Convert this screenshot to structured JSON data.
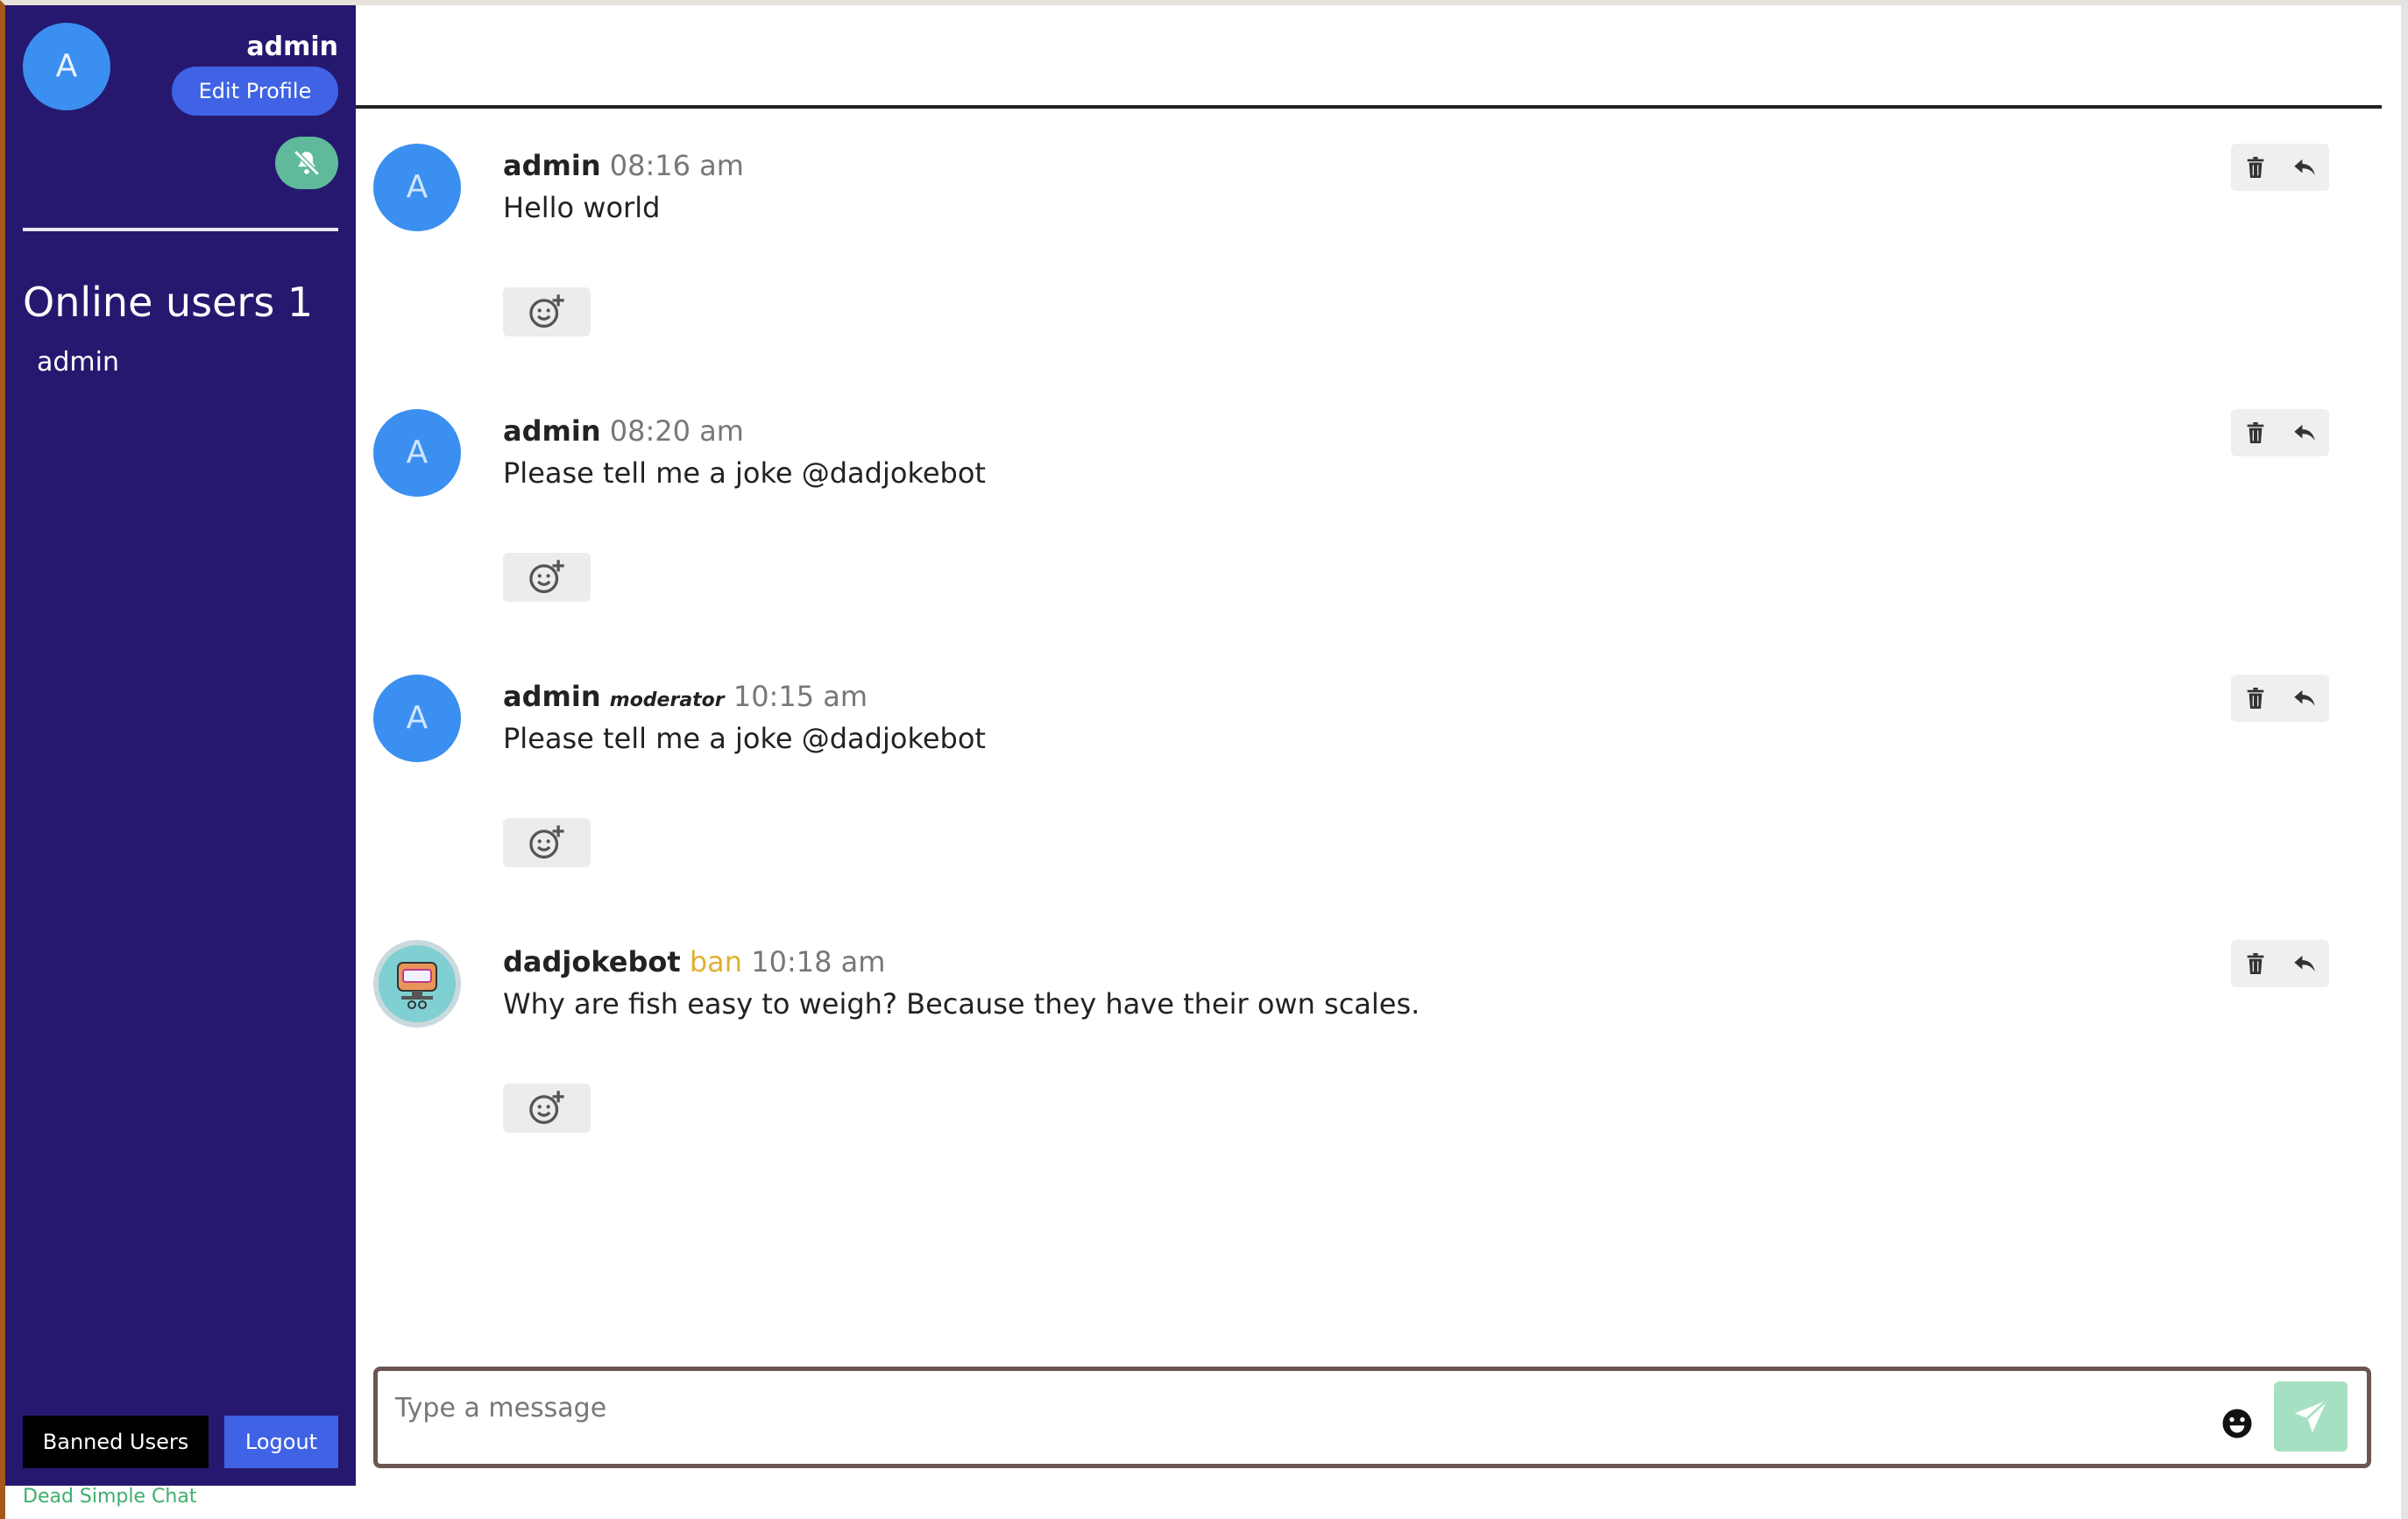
{
  "app": {
    "footer_link": "Dead Simple Chat"
  },
  "sidebar": {
    "avatar_letter": "A",
    "username": "admin",
    "edit_profile_label": "Edit Profile",
    "online_title": "Online users 1",
    "online_users": [
      "admin"
    ],
    "banned_users_label": "Banned Users",
    "logout_label": "Logout",
    "colors": {
      "background": "#26186f",
      "accent": "#3f63e4",
      "mute": "#5fb99a"
    }
  },
  "messages": [
    {
      "avatar_letter": "A",
      "author": "admin",
      "role": "",
      "ban": "",
      "time": "08:16 am",
      "text": "Hello world"
    },
    {
      "avatar_letter": "A",
      "author": "admin",
      "role": "",
      "ban": "",
      "time": "08:20 am",
      "text": "Please tell me a joke @dadjokebot"
    },
    {
      "avatar_letter": "A",
      "author": "admin",
      "role": "moderator",
      "ban": "",
      "time": "10:15 am",
      "text": "Please tell me a joke @dadjokebot"
    },
    {
      "avatar_letter": "",
      "author": "dadjokebot",
      "role": "",
      "ban": "ban",
      "time": "10:18 am",
      "text": "Why are fish easy to weigh? Because they have their own scales."
    }
  ],
  "composer": {
    "placeholder": "Type a message",
    "value": "",
    "icons": [
      "emoji-icon",
      "send-icon"
    ]
  },
  "icons": {
    "mute": "bell-slash-icon",
    "react": "emoji-add-icon",
    "delete": "trash-icon",
    "reply": "reply-icon"
  }
}
